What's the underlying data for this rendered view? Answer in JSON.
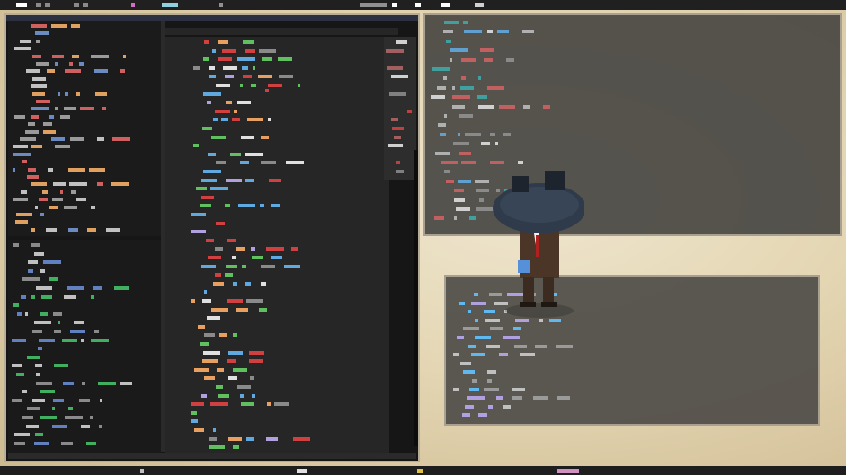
{
  "screen": {
    "width": 941,
    "height": 529
  },
  "taskbar": {
    "position": "top",
    "workspaces": [
      "1",
      "2",
      "3",
      "4",
      "5"
    ],
    "active_workspace": "1"
  },
  "bottom_panel": {
    "visible": true
  },
  "editor_window": {
    "title": "",
    "panes": [
      "file-sidebar",
      "file-tree",
      "code-editor",
      "minimap"
    ]
  },
  "terminal_top": {
    "title": ""
  },
  "terminal_bottom": {
    "title": ""
  },
  "wallpaper": {
    "subject": "character-with-dark-umbrella",
    "colors": {
      "bg": "#e4d6b3",
      "umbrella": "#2f3b4a",
      "suit": "#4a3526",
      "tie": "#b02020"
    }
  },
  "palette": {
    "code_orange": "#e8a060",
    "code_red": "#d04040",
    "code_green": "#60c060",
    "code_blue": "#60a8e0",
    "code_white": "#e0e0e0",
    "code_purple": "#b0a0e0"
  }
}
